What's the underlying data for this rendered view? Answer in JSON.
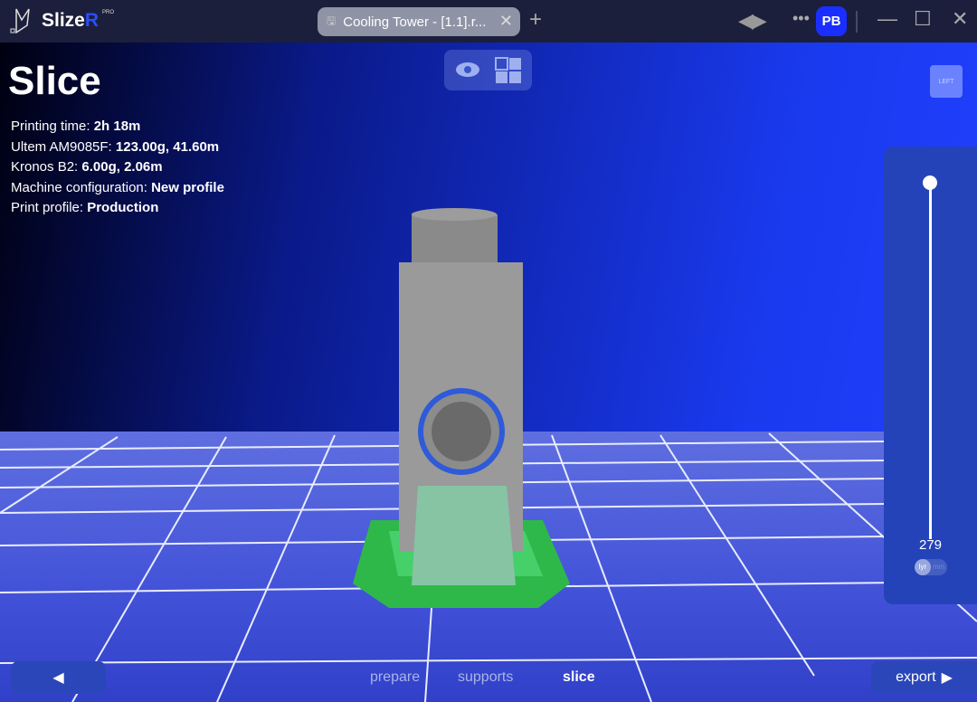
{
  "app": {
    "name": "Slize",
    "name_accent": "R",
    "badge": "PRO"
  },
  "tab": {
    "title": "Cooling Tower - [1.1].r...",
    "close": "✕",
    "new_tab": "+"
  },
  "header": {
    "user_initials": "PB",
    "more": "•••",
    "undo": "◀",
    "redo": "▶",
    "minimize": "—",
    "maximize": "☐",
    "close": "✕"
  },
  "page": {
    "title": "Slice"
  },
  "info": [
    {
      "label": "Printing time: ",
      "value": "2h 18m"
    },
    {
      "label": "Ultem AM9085F: ",
      "value": "123.00g, 41.60m"
    },
    {
      "label": "Kronos B2: ",
      "value": "6.00g, 2.06m"
    },
    {
      "label": "Machine configuration: ",
      "value": "New profile"
    },
    {
      "label": "Print profile: ",
      "value": "Production"
    }
  ],
  "view_cube": {
    "label": "LEFT"
  },
  "layer_slider": {
    "value": "279",
    "max_fraction": 1.0,
    "unit_selected": "lyr",
    "unit_other": "mm"
  },
  "footer": {
    "back_icon": "◀",
    "steps": [
      "prepare",
      "supports",
      "slice"
    ],
    "active_step": "slice",
    "export_label": "export",
    "export_icon": "▶"
  },
  "colors": {
    "accent": "#1a2eff",
    "support": "#2ec24a",
    "model": "#9a9a9a"
  }
}
